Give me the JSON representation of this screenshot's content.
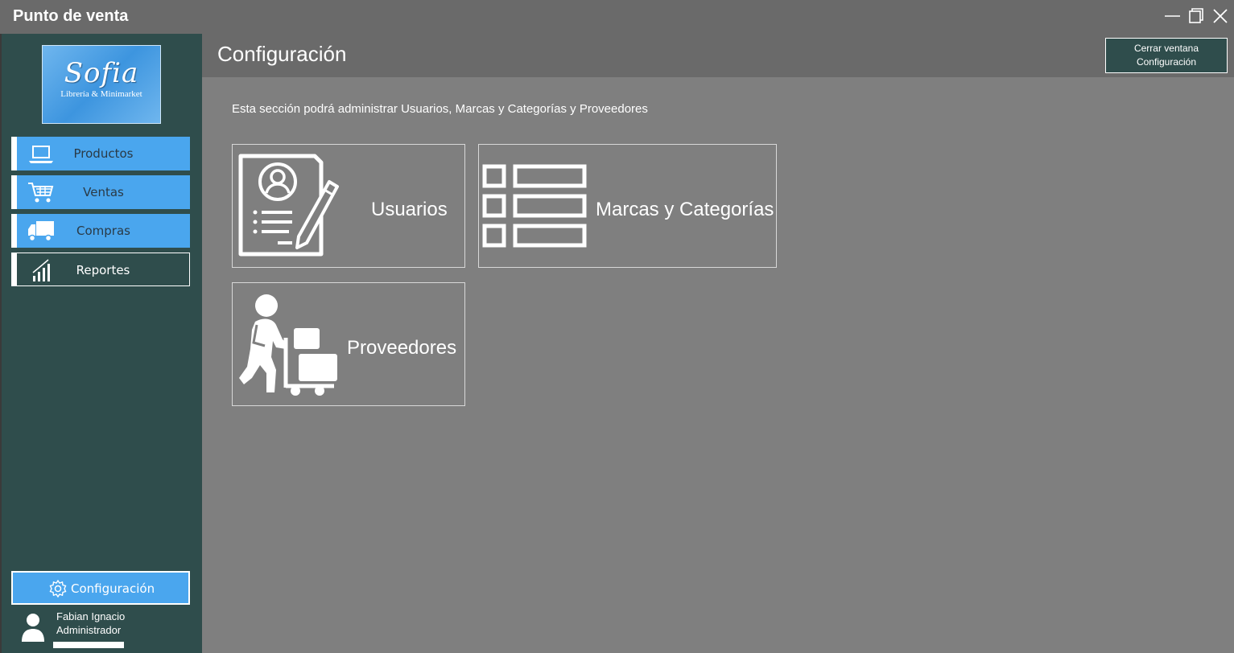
{
  "window": {
    "title": "Punto de venta",
    "controls": [
      "minimize-icon",
      "maximize-icon",
      "close-icon"
    ]
  },
  "sidebar": {
    "logo": {
      "main": "Sofia",
      "sub": "Librería & Minimarket"
    },
    "items": [
      {
        "label": "Productos",
        "icon": "laptop-icon"
      },
      {
        "label": "Ventas",
        "icon": "cart-icon"
      },
      {
        "label": "Compras",
        "icon": "truck-icon"
      },
      {
        "label": "Reportes",
        "icon": "chart-icon"
      }
    ],
    "config_label": "Configuración",
    "user": {
      "name": "Fabian Ignacio",
      "role": "Administrador"
    }
  },
  "header": {
    "title": "Configuración",
    "close_line1": "Cerrar ventana",
    "close_line2": "Configuración"
  },
  "main": {
    "description": "Esta sección podrá administrar Usuarios, Marcas y Categorías y Proveedores",
    "tiles": [
      {
        "label": "Usuarios",
        "icon": "user-document-icon"
      },
      {
        "label": "Marcas y Categorías",
        "icon": "list-icon"
      },
      {
        "label": "Proveedores",
        "icon": "delivery-person-icon"
      }
    ]
  },
  "colors": {
    "sidebar_bg": "#2f4d4c",
    "accent_blue": "#4aa6ee",
    "content_bg": "#7f7f7f",
    "header_bg": "#6a6a6a"
  }
}
